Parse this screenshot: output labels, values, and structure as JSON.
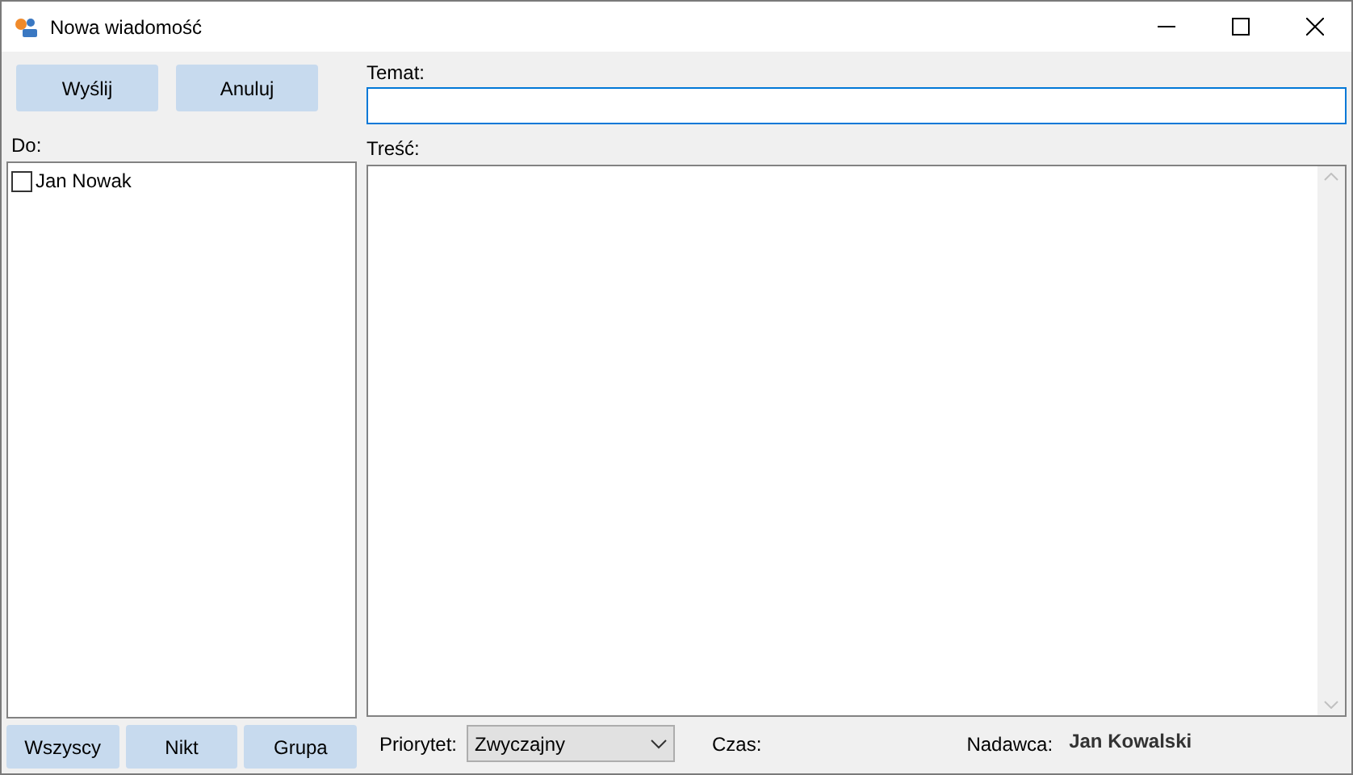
{
  "window": {
    "title": "Nowa wiadomość"
  },
  "actions": [
    {
      "label": "Wyślij"
    },
    {
      "label": "Anuluj"
    }
  ],
  "subject": {
    "label": "Temat:"
  },
  "recipients": {
    "label": "Do:",
    "items": [
      {
        "name": "Jan Nowak",
        "checked": false
      }
    ]
  },
  "body": {
    "label": "Treść:"
  },
  "recipient_buttons": [
    {
      "label": "Wszyscy"
    },
    {
      "label": "Nikt"
    },
    {
      "label": "Grupa"
    }
  ],
  "priority": {
    "label": "Priorytet:",
    "value": "Zwyczajny"
  },
  "time": {
    "label": "Czas:"
  },
  "sender": {
    "label": "Nadawca:",
    "value": "Jan Kowalski"
  }
}
